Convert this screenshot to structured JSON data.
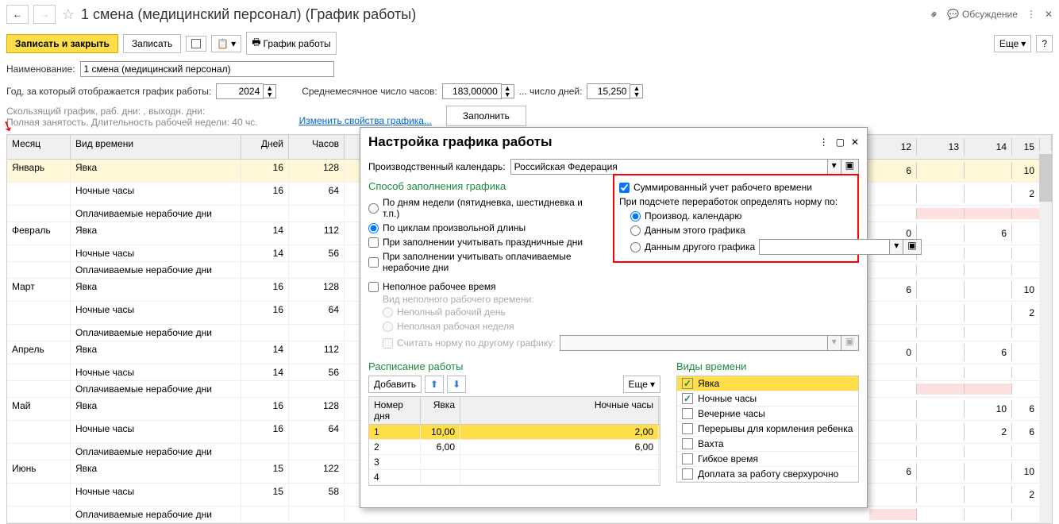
{
  "title": "1 смена (медицинский персонал) (График работы)",
  "discuss": "Обсуждение",
  "toolbar": {
    "save_close": "Записать и закрыть",
    "save": "Записать",
    "schedule": "График работы",
    "more": "Еще"
  },
  "form": {
    "name_lbl": "Наименование:",
    "name_val": "1 смена (медицинский персонал)",
    "year_lbl": "Год, за который отображается график работы:",
    "year_val": "2024",
    "avg_lbl": "Среднемесячное число часов:",
    "avg_val": "183,00000",
    "days_lbl": "... число дней:",
    "days_val": "15,250",
    "info1": "Скользящий график, раб. дни: , выходн. дни:",
    "info2": "Полная занятость. Длительность рабочей недели: 40 чс.",
    "change_link": "Изменить свойства графика...",
    "fill": "Заполнить"
  },
  "grid": {
    "hdr": {
      "m": "Месяц",
      "t": "Вид времени",
      "d": "Дней",
      "h": "Часов"
    },
    "day_hdrs": [
      "12",
      "13",
      "14",
      "15"
    ],
    "rows": [
      {
        "m": "Январь",
        "t": "Явка",
        "d": "16",
        "h": "128",
        "y": true,
        "cells": [
          "6",
          "",
          "",
          "10"
        ]
      },
      {
        "m": "",
        "t": "Ночные часы",
        "d": "16",
        "h": "64",
        "cells": [
          "",
          "",
          "",
          "2"
        ]
      },
      {
        "m": "",
        "t": "Оплачиваемые нерабочие дни",
        "d": "",
        "h": "",
        "cells": [
          "",
          "",
          "",
          ""
        ],
        "pink": [
          1,
          2,
          3
        ]
      },
      {
        "m": "Февраль",
        "t": "Явка",
        "d": "14",
        "h": "112",
        "cells": [
          "0",
          "",
          "6",
          ""
        ]
      },
      {
        "m": "",
        "t": "Ночные часы",
        "d": "14",
        "h": "56",
        "cells": [
          "",
          "",
          "",
          ""
        ]
      },
      {
        "m": "",
        "t": "Оплачиваемые нерабочие дни",
        "d": "",
        "h": "",
        "cells": [
          "",
          "",
          "",
          ""
        ]
      },
      {
        "m": "Март",
        "t": "Явка",
        "d": "16",
        "h": "128",
        "cells": [
          "6",
          "",
          "",
          "10"
        ]
      },
      {
        "m": "",
        "t": "Ночные часы",
        "d": "16",
        "h": "64",
        "cells": [
          "",
          "",
          "",
          "2"
        ]
      },
      {
        "m": "",
        "t": "Оплачиваемые нерабочие дни",
        "d": "",
        "h": "",
        "cells": [
          "",
          "",
          "",
          ""
        ]
      },
      {
        "m": "Апрель",
        "t": "Явка",
        "d": "14",
        "h": "112",
        "cells": [
          "0",
          "",
          "6",
          ""
        ]
      },
      {
        "m": "",
        "t": "Ночные часы",
        "d": "14",
        "h": "56",
        "cells": [
          "",
          "",
          "",
          ""
        ]
      },
      {
        "m": "",
        "t": "Оплачиваемые нерабочие дни",
        "d": "",
        "h": "",
        "cells": [
          "",
          "",
          "",
          ""
        ],
        "pink": [
          1,
          2
        ]
      },
      {
        "m": "Май",
        "t": "Явка",
        "d": "16",
        "h": "128",
        "cells": [
          "",
          "",
          "10",
          "6"
        ]
      },
      {
        "m": "",
        "t": "Ночные часы",
        "d": "16",
        "h": "64",
        "cells": [
          "",
          "",
          "2",
          "6"
        ]
      },
      {
        "m": "",
        "t": "Оплачиваемые нерабочие дни",
        "d": "",
        "h": "",
        "cells": [
          "",
          "",
          "",
          ""
        ]
      },
      {
        "m": "Июнь",
        "t": "Явка",
        "d": "15",
        "h": "122",
        "cells": [
          "6",
          "",
          "",
          "10"
        ]
      },
      {
        "m": "",
        "t": "Ночные часы",
        "d": "15",
        "h": "58",
        "cells": [
          "",
          "",
          "",
          "2"
        ]
      },
      {
        "m": "",
        "t": "Оплачиваемые нерабочие дни",
        "d": "",
        "h": "",
        "cells": [
          "",
          "",
          "",
          ""
        ],
        "pink": [
          0
        ]
      }
    ]
  },
  "modal": {
    "title": "Настройка графика работы",
    "cal_lbl": "Производственный календарь:",
    "cal_val": "Российская Федерация",
    "fill_method": "Способ заполнения графика",
    "r1": "По дням недели (пятидневка, шестидневка и т.п.)",
    "r2": "По циклам произвольной длины",
    "c1": "При заполнении учитывать праздничные дни",
    "c2": "При заполнении учитывать оплачиваемые нерабочие дни",
    "sum": "Суммированный учет рабочего времени",
    "norm_lbl": "При подсчете переработок определять норму по:",
    "n1": "Производ. календарю",
    "n2": "Данным этого графика",
    "n3": "Данным другого графика",
    "part": "Неполное рабочее время",
    "part_type": "Вид неполного рабочего времени:",
    "p1": "Неполный рабочий день",
    "p2": "Неполная рабочая неделя",
    "other_norm": "Считать норму по другому графику:",
    "sched": "Расписание работы",
    "types": "Виды времени",
    "add": "Добавить",
    "more": "Еще",
    "sh": {
      "n": "Номер дня",
      "y": "Явка",
      "nh": "Ночные часы"
    },
    "srows": [
      {
        "n": "1",
        "y": "10,00",
        "nh": "2,00",
        "sel": true
      },
      {
        "n": "2",
        "y": "6,00",
        "nh": "6,00"
      },
      {
        "n": "3",
        "y": "",
        "nh": ""
      },
      {
        "n": "4",
        "y": "",
        "nh": ""
      }
    ],
    "typelist": [
      {
        "l": "Явка",
        "c": true,
        "sel": true
      },
      {
        "l": "Ночные часы",
        "c": true
      },
      {
        "l": "Вечерние часы",
        "c": false
      },
      {
        "l": "Перерывы для кормления ребенка",
        "c": false
      },
      {
        "l": "Вахта",
        "c": false
      },
      {
        "l": "Гибкое время",
        "c": false
      },
      {
        "l": "Доплата за работу сверхурочно",
        "c": false
      }
    ]
  }
}
